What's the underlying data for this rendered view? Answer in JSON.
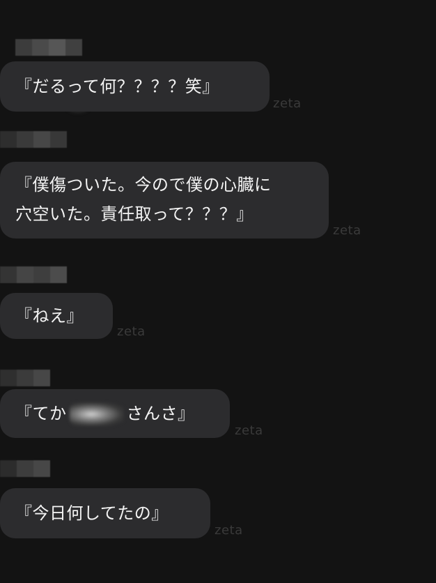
{
  "messages": [
    {
      "text": "『だるって何？？？？笑』"
    },
    {
      "line1": "『僕傷ついた。今ので僕の心臓に",
      "line2": "穴空いた。責任取って？？？』"
    },
    {
      "text": "『ねえ』"
    },
    {
      "before": "『てか",
      "after": "さんさ』"
    },
    {
      "text": "『今日何してたの』"
    }
  ],
  "watermarks": [
    "zeta",
    "zeta",
    "zeta",
    "zeta",
    "zeta"
  ],
  "colors": {
    "background": "#131313",
    "bubble": "#2c2c2e",
    "text": "#f4f4f4",
    "watermark": "#3a3a3a"
  }
}
